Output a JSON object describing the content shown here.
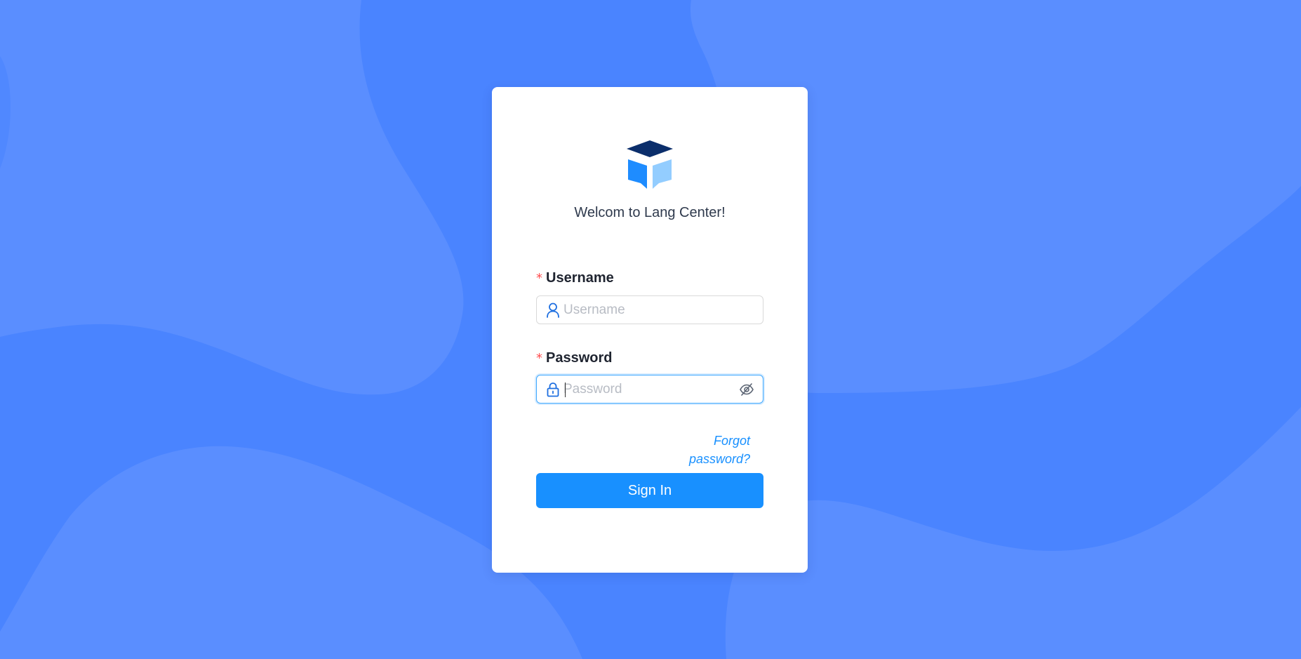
{
  "theme": {
    "background": "#4a84ff",
    "blob_light": "#5a8eff",
    "card": "#ffffff",
    "primary": "#1890ff",
    "required": "#ff4d4f"
  },
  "logo": {
    "icon": "book-cap-logo-icon",
    "colors": [
      "#0b2e6b",
      "#1e8cff",
      "#93cdff"
    ]
  },
  "welcome_text": "Welcom to Lang Center!",
  "form": {
    "username": {
      "label": "Username",
      "required_mark": "*",
      "placeholder": "Username",
      "value": "",
      "icon": "user-icon"
    },
    "password": {
      "label": "Password",
      "required_mark": "*",
      "placeholder": "Password",
      "value": "",
      "icon": "lock-icon",
      "toggle_icon": "eye-slash-icon",
      "focused": true
    },
    "forgot_link": "Forgot password?",
    "submit_label": "Sign In"
  }
}
